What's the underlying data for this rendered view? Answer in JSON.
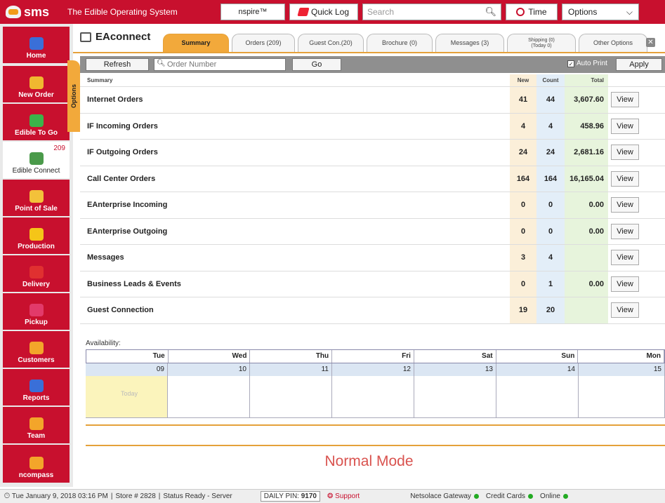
{
  "app": {
    "logo": "sms",
    "tagline": "The Edible Operating System",
    "nspire": "nspire™",
    "quick_log": "Quick Log",
    "search_placeholder": "Search",
    "time": "Time",
    "options": "Options"
  },
  "sidebar": {
    "items": [
      {
        "label": "Home",
        "icon": "home-icon",
        "color": "#3a6fd8"
      },
      {
        "label": "New Order",
        "icon": "new-order-icon",
        "color": "#f0b830"
      },
      {
        "label": "Edible To Go",
        "icon": "edible-to-go-icon",
        "color": "#3bb34a"
      },
      {
        "label": "Edible Connect",
        "icon": "edible-connect-icon",
        "color": "#4a9a4a",
        "badge": "209"
      },
      {
        "label": "Point of Sale",
        "icon": "point-of-sale-icon",
        "color": "#f3c13a"
      },
      {
        "label": "Production",
        "icon": "production-icon",
        "color": "#f5c518"
      },
      {
        "label": "Delivery",
        "icon": "delivery-icon",
        "color": "#e03030"
      },
      {
        "label": "Pickup",
        "icon": "pickup-icon",
        "color": "#e23a6a"
      },
      {
        "label": "Customers",
        "icon": "customers-icon",
        "color": "#f3a52a"
      },
      {
        "label": "Reports",
        "icon": "reports-icon",
        "color": "#3a6fd8"
      },
      {
        "label": "Team",
        "icon": "team-icon",
        "color": "#f3a52a"
      },
      {
        "label": "ncompass",
        "icon": "ncompass-icon",
        "color": "#f3a52a"
      }
    ]
  },
  "panel": {
    "title": "EAconnect",
    "tabs": [
      {
        "label": "Summary"
      },
      {
        "label": "Orders (209)"
      },
      {
        "label": "Guest Con.(20)"
      },
      {
        "label": "Brochure (0)"
      },
      {
        "label": "Messages (3)"
      },
      {
        "label": "Shipping (0)\n(Today 0)"
      },
      {
        "label": "Other Options"
      }
    ]
  },
  "toolbar": {
    "refresh": "Refresh",
    "order_placeholder": "Order Number",
    "go": "Go",
    "auto_print": "Auto Print",
    "apply": "Apply",
    "options_tab": "Options"
  },
  "summary": {
    "headers": {
      "label": "Summary",
      "new": "New",
      "count": "Count",
      "total": "Total"
    },
    "rows": [
      {
        "label": "Internet Orders",
        "new": "41",
        "count": "44",
        "total": "3,607.60",
        "view": "View"
      },
      {
        "label": "IF Incoming Orders",
        "new": "4",
        "count": "4",
        "total": "458.96",
        "view": "View"
      },
      {
        "label": "IF Outgoing Orders",
        "new": "24",
        "count": "24",
        "total": "2,681.16",
        "view": "View"
      },
      {
        "label": "Call Center Orders",
        "new": "164",
        "count": "164",
        "total": "16,165.04",
        "view": "View"
      },
      {
        "label": "EAnterprise Incoming",
        "new": "0",
        "count": "0",
        "total": "0.00",
        "view": "View"
      },
      {
        "label": "EAnterprise Outgoing",
        "new": "0",
        "count": "0",
        "total": "0.00",
        "view": "View"
      },
      {
        "label": "Messages",
        "new": "3",
        "count": "4",
        "total": "",
        "view": "View"
      },
      {
        "label": "Business Leads & Events",
        "new": "0",
        "count": "1",
        "total": "0.00",
        "view": "View"
      },
      {
        "label": "Guest Connection",
        "new": "19",
        "count": "20",
        "total": "",
        "view": "View"
      }
    ]
  },
  "availability": {
    "label": "Availability:",
    "days": [
      "Tue",
      "Wed",
      "Thu",
      "Fri",
      "Sat",
      "Sun",
      "Mon"
    ],
    "dates": [
      "09",
      "10",
      "11",
      "12",
      "13",
      "14",
      "15"
    ],
    "today": "Today"
  },
  "mode": "Normal Mode",
  "status": {
    "datetime": "Tue January 9, 2018  03:16 PM",
    "store": "Store # 2828",
    "state": "Status  Ready - Server",
    "pin_label": "DAILY PIN:",
    "pin": "9170",
    "support": "Support",
    "gateway": "Netsolace Gateway",
    "credit": "Credit Cards",
    "online": "Online"
  }
}
